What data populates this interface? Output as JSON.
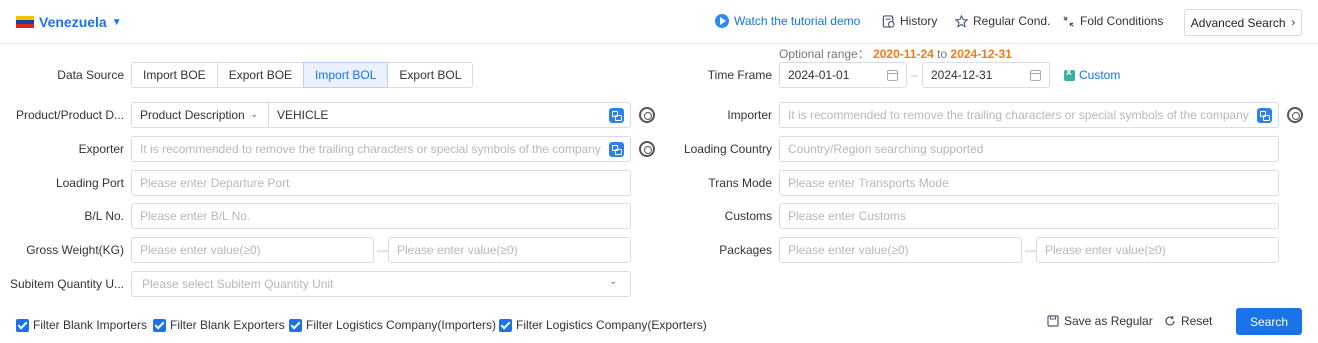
{
  "header": {
    "country": "Venezuela",
    "tutorial": "Watch the tutorial demo",
    "history": "History",
    "regular_cond": "Regular Cond.",
    "fold_conditions": "Fold Conditions",
    "advanced_search": "Advanced Search"
  },
  "optional_range": {
    "label": "Optional range：",
    "start": "2020-11-24",
    "to": "to",
    "end": "2024-12-31"
  },
  "data_source": {
    "label": "Data Source",
    "options": [
      "Import BOE",
      "Export BOE",
      "Import BOL",
      "Export BOL"
    ],
    "selected": "Import BOL"
  },
  "time_frame": {
    "label": "Time Frame",
    "start": "2024-01-01",
    "end": "2024-12-31",
    "custom": "Custom"
  },
  "product": {
    "label": "Product/Product D...",
    "type": "Product Description",
    "value": "VEHICLE"
  },
  "importer": {
    "label": "Importer",
    "placeholder": "It is recommended to remove the trailing characters or special symbols of the company"
  },
  "exporter": {
    "label": "Exporter",
    "placeholder": "It is recommended to remove the trailing characters or special symbols of the company"
  },
  "loading_country": {
    "label": "Loading Country",
    "placeholder": "Country/Region searching supported"
  },
  "loading_port": {
    "label": "Loading Port",
    "placeholder": "Please enter Departure Port"
  },
  "trans_mode": {
    "label": "Trans Mode",
    "placeholder": "Please enter Transports Mode"
  },
  "bl_no": {
    "label": "B/L No.",
    "placeholder": "Please enter B/L No."
  },
  "customs": {
    "label": "Customs",
    "placeholder": "Please enter Customs"
  },
  "gross_weight": {
    "label": "Gross Weight(KG)",
    "min_placeholder": "Please enter value(≥0)",
    "max_placeholder": "Please enter value(≥0)"
  },
  "packages": {
    "label": "Packages",
    "min_placeholder": "Please enter value(≥0)",
    "max_placeholder": "Please enter value(≥0)"
  },
  "subitem_unit": {
    "label": "Subitem Quantity U...",
    "placeholder": "Please select Subitem Quantity Unit"
  },
  "filters": [
    "Filter Blank Importers",
    "Filter Blank Exporters",
    "Filter Logistics Company(Importers)",
    "Filter Logistics Company(Exporters)"
  ],
  "actions": {
    "save_as_regular": "Save as Regular",
    "reset": "Reset",
    "search": "Search"
  },
  "colors": {
    "accent": "#1a73e8",
    "date_highlight": "#f07d17"
  }
}
